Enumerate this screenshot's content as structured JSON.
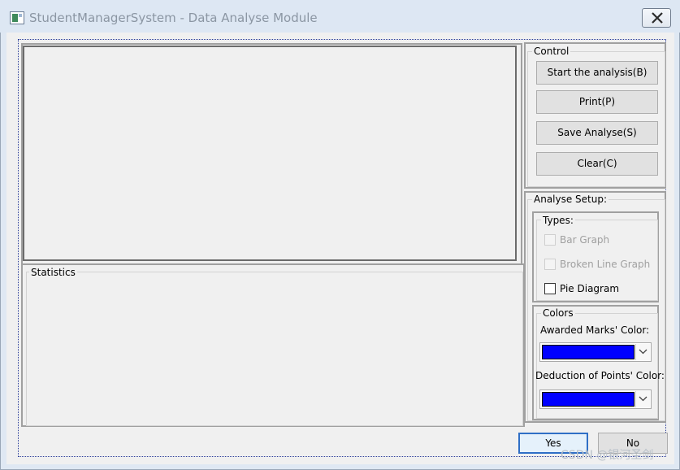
{
  "window": {
    "title": "StudentManagerSystem - Data Analyse Module"
  },
  "statistics": {
    "label": "Statistics"
  },
  "control": {
    "label": "Control",
    "buttons": [
      {
        "label": "Start the analysis(B)"
      },
      {
        "label": "Print(P)"
      },
      {
        "label": "Save Analyse(S)"
      },
      {
        "label": "Clear(C)"
      }
    ]
  },
  "setup": {
    "label": "Analyse Setup:",
    "types": {
      "label": "Types:",
      "options": [
        {
          "label": "Bar Graph",
          "enabled": false,
          "checked": false
        },
        {
          "label": "Broken Line Graph",
          "enabled": false,
          "checked": false
        },
        {
          "label": "Pie Diagram",
          "enabled": true,
          "checked": false
        }
      ]
    },
    "colors": {
      "label": "Colors",
      "awarded_label": "Awarded Marks' Color:",
      "awarded_color": "#0000ff",
      "deduction_label": "Deduction of Points' Color:",
      "deduction_color": "#0000ff"
    }
  },
  "footer": {
    "yes_label": "Yes",
    "no_label": "No",
    "watermark": "CSDN @银河圣剑"
  }
}
